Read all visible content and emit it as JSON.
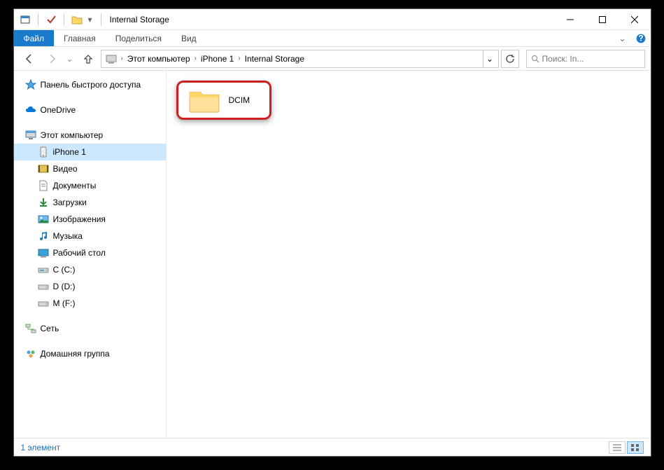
{
  "title": "Internal Storage",
  "ribbon": {
    "file": "Файл",
    "tabs": [
      "Главная",
      "Поделиться",
      "Вид"
    ]
  },
  "breadcrumbs": [
    "Этот компьютер",
    "iPhone 1",
    "Internal Storage"
  ],
  "search_placeholder": "Поиск: In...",
  "sidebar": {
    "quick": "Панель быстрого доступа",
    "onedrive": "OneDrive",
    "thispc": "Этот компьютер",
    "children": [
      {
        "label": "iPhone 1"
      },
      {
        "label": "Видео"
      },
      {
        "label": "Документы"
      },
      {
        "label": "Загрузки"
      },
      {
        "label": "Изображения"
      },
      {
        "label": "Музыка"
      },
      {
        "label": "Рабочий стол"
      },
      {
        "label": "C (C:)"
      },
      {
        "label": "D (D:)"
      },
      {
        "label": "M (F:)"
      }
    ],
    "network": "Сеть",
    "homegroup": "Домашняя группа"
  },
  "folder_name": "DCIM",
  "status_text": "1 элемент"
}
